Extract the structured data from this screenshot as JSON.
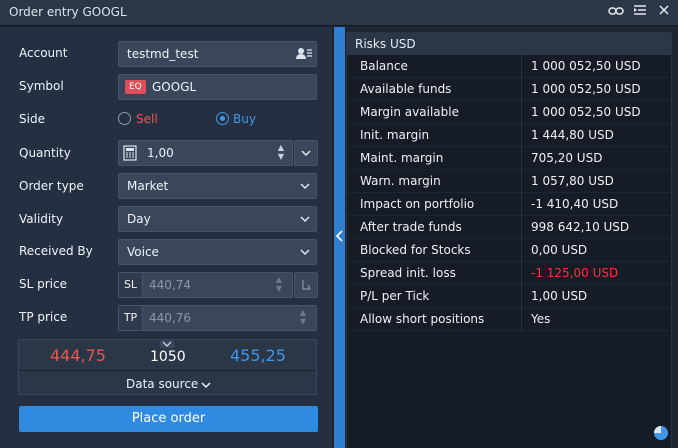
{
  "window": {
    "title": "Order entry GOOGL"
  },
  "form": {
    "account": {
      "label": "Account",
      "value": "testmd_test"
    },
    "symbol": {
      "label": "Symbol",
      "badge": "EQ",
      "value": "GOOGL"
    },
    "side": {
      "label": "Side",
      "sell": "Sell",
      "buy": "Buy",
      "selected": "Buy"
    },
    "quantity": {
      "label": "Quantity",
      "value": "1,00"
    },
    "order_type": {
      "label": "Order type",
      "value": "Market"
    },
    "validity": {
      "label": "Validity",
      "value": "Day"
    },
    "received_by": {
      "label": "Received By",
      "value": "Voice"
    },
    "sl_price": {
      "label": "SL price",
      "prefix": "SL",
      "value": "440,74"
    },
    "tp_price": {
      "label": "TP price",
      "prefix": "TP",
      "value": "440,76"
    }
  },
  "quote": {
    "bid": "444,75",
    "size": "1050",
    "ask": "455,25",
    "data_source": "Data source"
  },
  "place_order": "Place order",
  "risks": {
    "title": "Risks USD",
    "rows": [
      {
        "key": "Balance",
        "value": "1 000 052,50 USD"
      },
      {
        "key": "Available  funds",
        "value": "1 000 052,50 USD"
      },
      {
        "key": "Margin available",
        "value": "1 000 052,50 USD"
      },
      {
        "key": "Init. margin",
        "value": "1 444,80 USD"
      },
      {
        "key": "Maint. margin",
        "value": "705,20 USD"
      },
      {
        "key": "Warn. margin",
        "value": "1 057,80 USD"
      },
      {
        "key": "Impact on portfolio",
        "value": "-1 410,40 USD"
      },
      {
        "key": "After trade funds",
        "value": "998 642,10 USD"
      },
      {
        "key": "Blocked for Stocks",
        "value": "0,00 USD"
      },
      {
        "key": "Spread init. loss",
        "value": "-1 125,00 USD",
        "negative": true
      },
      {
        "key": "P/L per Tick",
        "value": "1,00 USD"
      },
      {
        "key": "Allow short positions",
        "value": "Yes"
      }
    ]
  },
  "colors": {
    "sell": "#e8574f",
    "buy": "#3f97e6",
    "negative": "#ff2f3a",
    "accent": "#2f8be0"
  },
  "icons": [
    "link-icon",
    "collapse-menu-icon",
    "close-icon",
    "user-list-icon",
    "calculator-icon",
    "chevron-down-icon",
    "chevron-left-icon",
    "pie-chart-icon"
  ]
}
